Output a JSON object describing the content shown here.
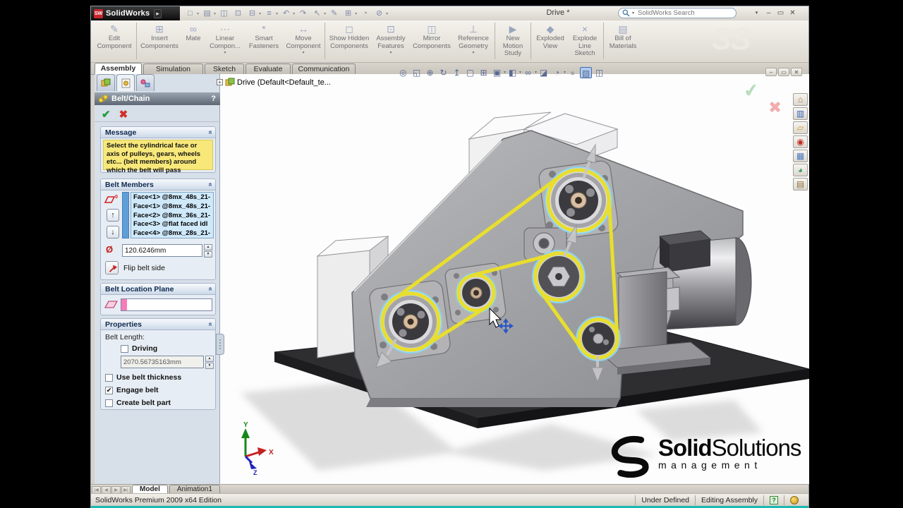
{
  "icons": {
    "ok": "✔",
    "cancel": "✖",
    "help": "?",
    "up_arrow": "↑",
    "down_arrow": "↓",
    "collapse_chevron": "«",
    "spinner_up": "▲",
    "spinner_down": "▼",
    "minimize": "–",
    "maximize": "▭",
    "close": "✕",
    "dropdown": "▾",
    "diameter": "Ø",
    "expand_plus": "+",
    "logo_arrow": "▸"
  },
  "titlebar": {
    "logo_monogram": "SW",
    "app_name": "SolidWorks",
    "document_title": "Drive *",
    "search_placeholder": "SolidWorks Search"
  },
  "std_toolbar": {
    "icons": [
      {
        "name": "new",
        "glyph": "□"
      },
      {
        "name": "open",
        "glyph": "▤"
      },
      {
        "name": "make-drawing",
        "glyph": "◫"
      },
      {
        "name": "make-assembly",
        "glyph": "⊡"
      },
      {
        "name": "save",
        "glyph": "⊟"
      },
      {
        "name": "print",
        "glyph": "≡"
      },
      {
        "name": "undo",
        "glyph": "↶"
      },
      {
        "name": "redo",
        "glyph": "↷"
      },
      {
        "name": "select",
        "glyph": "↖"
      },
      {
        "name": "sketch",
        "glyph": "✎"
      },
      {
        "name": "rebuild",
        "glyph": "⊞"
      },
      {
        "name": "options",
        "glyph": "◔"
      },
      {
        "name": "toolbox",
        "glyph": "⊘"
      }
    ]
  },
  "command_manager": {
    "buttons": [
      {
        "label": "Edit Component",
        "icon": "✎"
      },
      {
        "label": "Insert Components",
        "icon": "⊞"
      },
      {
        "label": "Mate",
        "icon": "∞"
      },
      {
        "label": "Linear Compon...",
        "icon": "⋯"
      },
      {
        "label": "Smart Fasteners",
        "icon": "*"
      },
      {
        "label": "Move Component",
        "icon": "↔"
      },
      {
        "label": "Show Hidden Components",
        "icon": "◻"
      },
      {
        "label": "Assembly Features",
        "icon": "⊡"
      },
      {
        "label": "Mirror Components",
        "icon": "◫"
      },
      {
        "label": "Reference Geometry",
        "icon": "⊥"
      },
      {
        "label": "New Motion Study",
        "icon": "▶"
      },
      {
        "label": "Exploded View",
        "icon": "◆"
      },
      {
        "label": "Explode Line Sketch",
        "icon": "×"
      },
      {
        "label": "Bill of Materials",
        "icon": "▤"
      }
    ]
  },
  "ribbon_tabs": {
    "active": "Assembly",
    "tabs": [
      {
        "label": "Assembly"
      },
      {
        "label": "Simulation"
      },
      {
        "label": "Sketch"
      },
      {
        "label": "Evaluate"
      },
      {
        "label": "Communication"
      }
    ]
  },
  "heads_up": {
    "icons": [
      {
        "name": "zoom-fit",
        "glyph": "◎"
      },
      {
        "name": "zoom-area",
        "glyph": "◱"
      },
      {
        "name": "zoom-in-out",
        "glyph": "⊕"
      },
      {
        "name": "rotate-view",
        "glyph": "↻"
      },
      {
        "name": "normal-to",
        "glyph": "↥"
      },
      {
        "name": "previous-view",
        "glyph": "▢"
      },
      {
        "name": "grid",
        "glyph": "⊞"
      },
      {
        "name": "view-orientation",
        "glyph": "▣"
      },
      {
        "name": "display-style",
        "glyph": "◧"
      },
      {
        "name": "hide-show-items",
        "glyph": "∞"
      },
      {
        "name": "section-view",
        "glyph": "◪"
      },
      {
        "name": "appearances",
        "glyph": "◔"
      },
      {
        "name": "shadows",
        "glyph": "●"
      },
      {
        "name": "shaded-with-edges",
        "glyph": "▧"
      },
      {
        "name": "perspective",
        "glyph": "◫"
      }
    ]
  },
  "doc_tree": {
    "root": "Drive  (Default<Default_te..."
  },
  "property_manager": {
    "title": "Belt/Chain",
    "help": "?",
    "message": {
      "header": "Message",
      "text": "Select the cylindrical face or axis of pulleys, gears, wheels etc... (belt members) around which the belt will pass"
    },
    "belt_members": {
      "header": "Belt Members",
      "badge": "0",
      "items": [
        {
          "label": "Face<1> @8mx_48s_21-"
        },
        {
          "label": "Face<1> @8mx_48s_21-"
        },
        {
          "label": "Face<2> @8mx_36s_21-"
        },
        {
          "label": "Face<3> @flat faced idl"
        },
        {
          "label": "Face<4> @8mx_28s_21-"
        }
      ]
    },
    "diameter": {
      "value": "120.6246mm"
    },
    "flip_button": {
      "label": "Flip belt side"
    },
    "belt_location_plane": {
      "header": "Belt Location Plane"
    },
    "properties": {
      "header": "Properties",
      "belt_length_label": "Belt Length:",
      "driving": {
        "label": "Driving",
        "mark": ""
      },
      "belt_length_value": "2070.56735163mm",
      "use_belt_thickness": {
        "label": "Use belt thickness",
        "mark": ""
      },
      "engage_belt": {
        "label": "Engage belt",
        "mark": "✔"
      },
      "create_belt_part": {
        "label": "Create belt part",
        "mark": ""
      }
    }
  },
  "task_pane": {
    "icons": [
      {
        "name": "solidworks-resources",
        "glyph": "⌂",
        "color": "#b86a18"
      },
      {
        "name": "design-library",
        "glyph": "▥",
        "color": "#3a62b8"
      },
      {
        "name": "file-explorer",
        "glyph": "▱",
        "color": "#d8a018"
      },
      {
        "name": "solidworks-search",
        "glyph": "◉",
        "color": "#c03028"
      },
      {
        "name": "view-palette",
        "glyph": "▦",
        "color": "#4878c0"
      },
      {
        "name": "appearances-scenes",
        "glyph": "◕",
        "color": "#40a060"
      },
      {
        "name": "custom-properties",
        "glyph": "▤",
        "color": "#907040"
      }
    ]
  },
  "viewport": {
    "triad": {
      "x": "X",
      "y": "Y",
      "z": "Z"
    }
  },
  "branding": {
    "logo_bold": "Solid",
    "logo_regular": "Solutions",
    "logo_sub": "management"
  },
  "bottom_tabs": {
    "active": "Model",
    "tabs": [
      {
        "label": "Model"
      },
      {
        "label": "Animation1"
      }
    ]
  },
  "status_bar": {
    "edition": "SolidWorks Premium 2009 x64 Edition",
    "define_state": "Under Defined",
    "mode": "Editing Assembly"
  },
  "colors": {
    "belt": "#e8de2e",
    "selection_highlight": "#8ad6f2",
    "message_bg": "#f8e87a",
    "teal_strip": "#1cb8b2",
    "accent_red": "#c42222"
  }
}
